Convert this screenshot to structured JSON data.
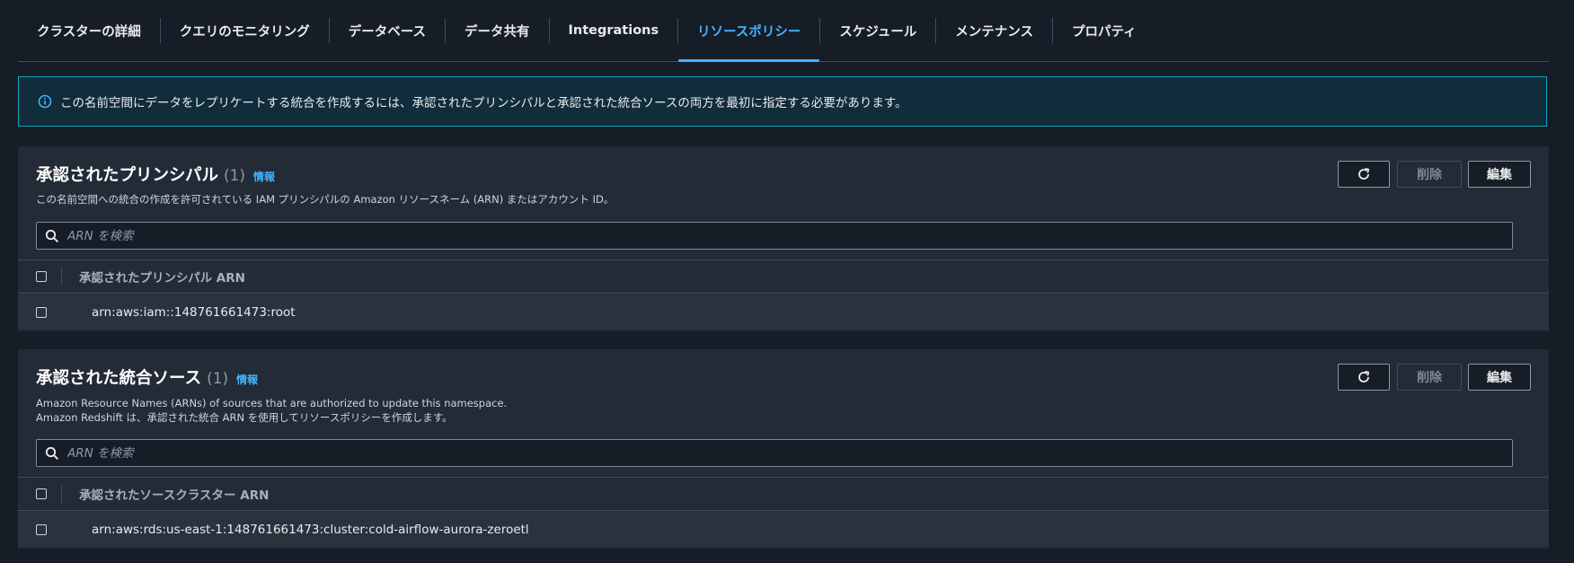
{
  "tabs": [
    {
      "label": "クラスターの詳細"
    },
    {
      "label": "クエリのモニタリング"
    },
    {
      "label": "データベース"
    },
    {
      "label": "データ共有"
    },
    {
      "label": "Integrations"
    },
    {
      "label": "リソースポリシー",
      "active": true
    },
    {
      "label": "スケジュール"
    },
    {
      "label": "メンテナンス"
    },
    {
      "label": "プロパティ"
    }
  ],
  "banner": {
    "text": "この名前空間にデータをレプリケートする統合を作成するには、承認されたプリンシパルと承認された統合ソースの両方を最初に指定する必要があります。",
    "icon": "info-icon"
  },
  "principals": {
    "title": "承認されたプリンシパル",
    "count": "(1)",
    "info": "情報",
    "description": "この名前空間への統合の作成を許可されている IAM プリンシパルの Amazon リソースネーム (ARN) またはアカウント ID。",
    "delete_label": "削除",
    "edit_label": "編集",
    "search_placeholder": "ARN を検索",
    "column_header": "承認されたプリンシパル ARN",
    "rows": [
      "arn:aws:iam::148761661473:root"
    ]
  },
  "sources": {
    "title": "承認された統合ソース",
    "count": "(1)",
    "info": "情報",
    "description_line1": "Amazon Resource Names (ARNs) of sources that are authorized to update this namespace.",
    "description_line2": "Amazon Redshift は、承認された統合 ARN を使用してリソースポリシーを作成します。",
    "delete_label": "削除",
    "edit_label": "編集",
    "search_placeholder": "ARN を検索",
    "column_header": "承認されたソースクラスター ARN",
    "rows": [
      "arn:aws:rds:us-east-1:148761661473:cluster:cold-airflow-aurora-zeroetl"
    ]
  },
  "colors": {
    "accent": "#42b4ff",
    "background": "#161d26",
    "panel": "#232b37",
    "banner_border": "#0ea5b7"
  }
}
